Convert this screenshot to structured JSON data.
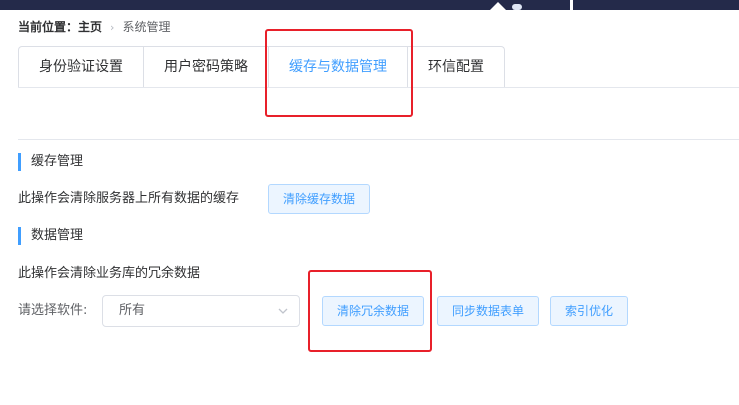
{
  "breadcrumb": {
    "prefix": "当前位置：",
    "home": "主页",
    "separator": "›",
    "current": "系统管理"
  },
  "tabs": [
    {
      "label": "身份验证设置",
      "active": false
    },
    {
      "label": "用户密码策略",
      "active": false
    },
    {
      "label": "缓存与数据管理",
      "active": true
    },
    {
      "label": "环信配置",
      "active": false
    }
  ],
  "cache_section": {
    "title": "缓存管理",
    "description": "此操作会清除服务器上所有数据的缓存",
    "clear_button": "清除缓存数据"
  },
  "data_section": {
    "title": "数据管理",
    "description": "此操作会清除业务库的冗余数据",
    "software_label": "请选择软件:",
    "software_select": {
      "value": "所有",
      "icon": "chevron-down-icon"
    },
    "clear_redundant_button": "清除冗余数据",
    "sync_button": "同步数据表单",
    "index_button": "索引优化"
  },
  "colors": {
    "accent": "#409eff",
    "button_bg": "#ecf5ff",
    "button_border": "#b3d8ff",
    "highlight": "#e8202a",
    "topbar": "#242a4a"
  }
}
